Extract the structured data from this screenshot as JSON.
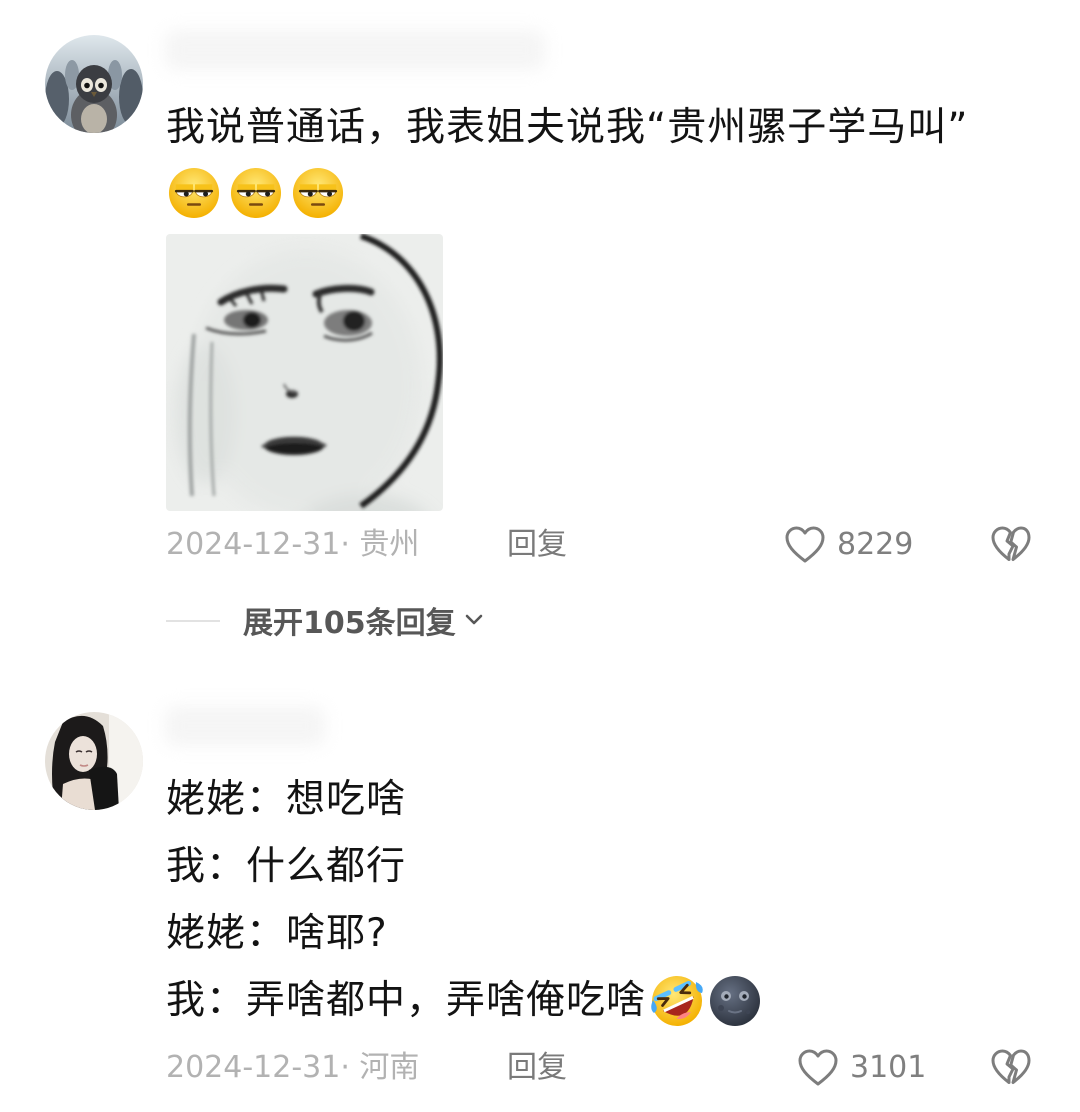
{
  "comments": [
    {
      "lines": [
        "我说普通话，我表姐夫说我“贵州骡子学马叫”"
      ],
      "emojis": [
        "unamused-face-icon",
        "unamused-face-icon",
        "unamused-face-icon"
      ],
      "image": "meme-face-image",
      "date_location": "2024-12-31· 贵州",
      "reply_label": "回复",
      "like_count": "8229",
      "expand_replies_label": "展开105条回复"
    },
    {
      "lines": [
        "姥姥：想吃啥",
        "我：什么都行",
        "姥姥：啥耶?",
        "我：弄啥都中，弄啥俺吃啥"
      ],
      "emojis": [
        "rolling-laughing-face-icon",
        "new-moon-face-icon"
      ],
      "date_location": "2024-12-31· 河南",
      "reply_label": "回复",
      "like_count": "3101"
    }
  ],
  "icons": {
    "like": "heart-outline-icon",
    "dislike": "broken-heart-icon",
    "expand": "chevron-down-icon"
  },
  "colors": {
    "text": "#131313",
    "meta": "#b2b2b2",
    "action": "#7a7a7a",
    "expand": "#575757"
  }
}
